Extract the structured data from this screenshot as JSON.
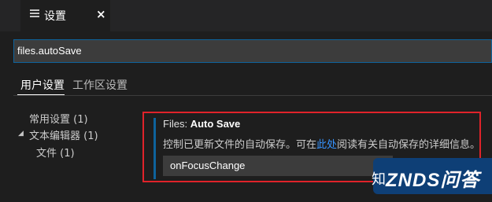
{
  "tab": {
    "title": "设置",
    "icon": "settings-editor-icon",
    "close": "×"
  },
  "search": {
    "value": "files.autoSave"
  },
  "scopes": {
    "user": "用户设置",
    "workspace": "工作区设置"
  },
  "tree": {
    "common": "常用设置 (1)",
    "text_editor": "文本编辑器 (1)",
    "files": "文件 (1)"
  },
  "setting": {
    "category": "Files:",
    "name": "Auto Save",
    "desc_before": "控制已更新文件的自动保存。可在",
    "desc_link": "此处",
    "desc_after": "阅读有关自动保存的详细信息。",
    "value": "onFocusChange"
  },
  "watermark": {
    "zh_fragment": "知",
    "brand": "ZNDS问答"
  },
  "colors": {
    "accent": "#0e639c",
    "highlight_border": "#e0232a",
    "link": "#3794ff"
  }
}
